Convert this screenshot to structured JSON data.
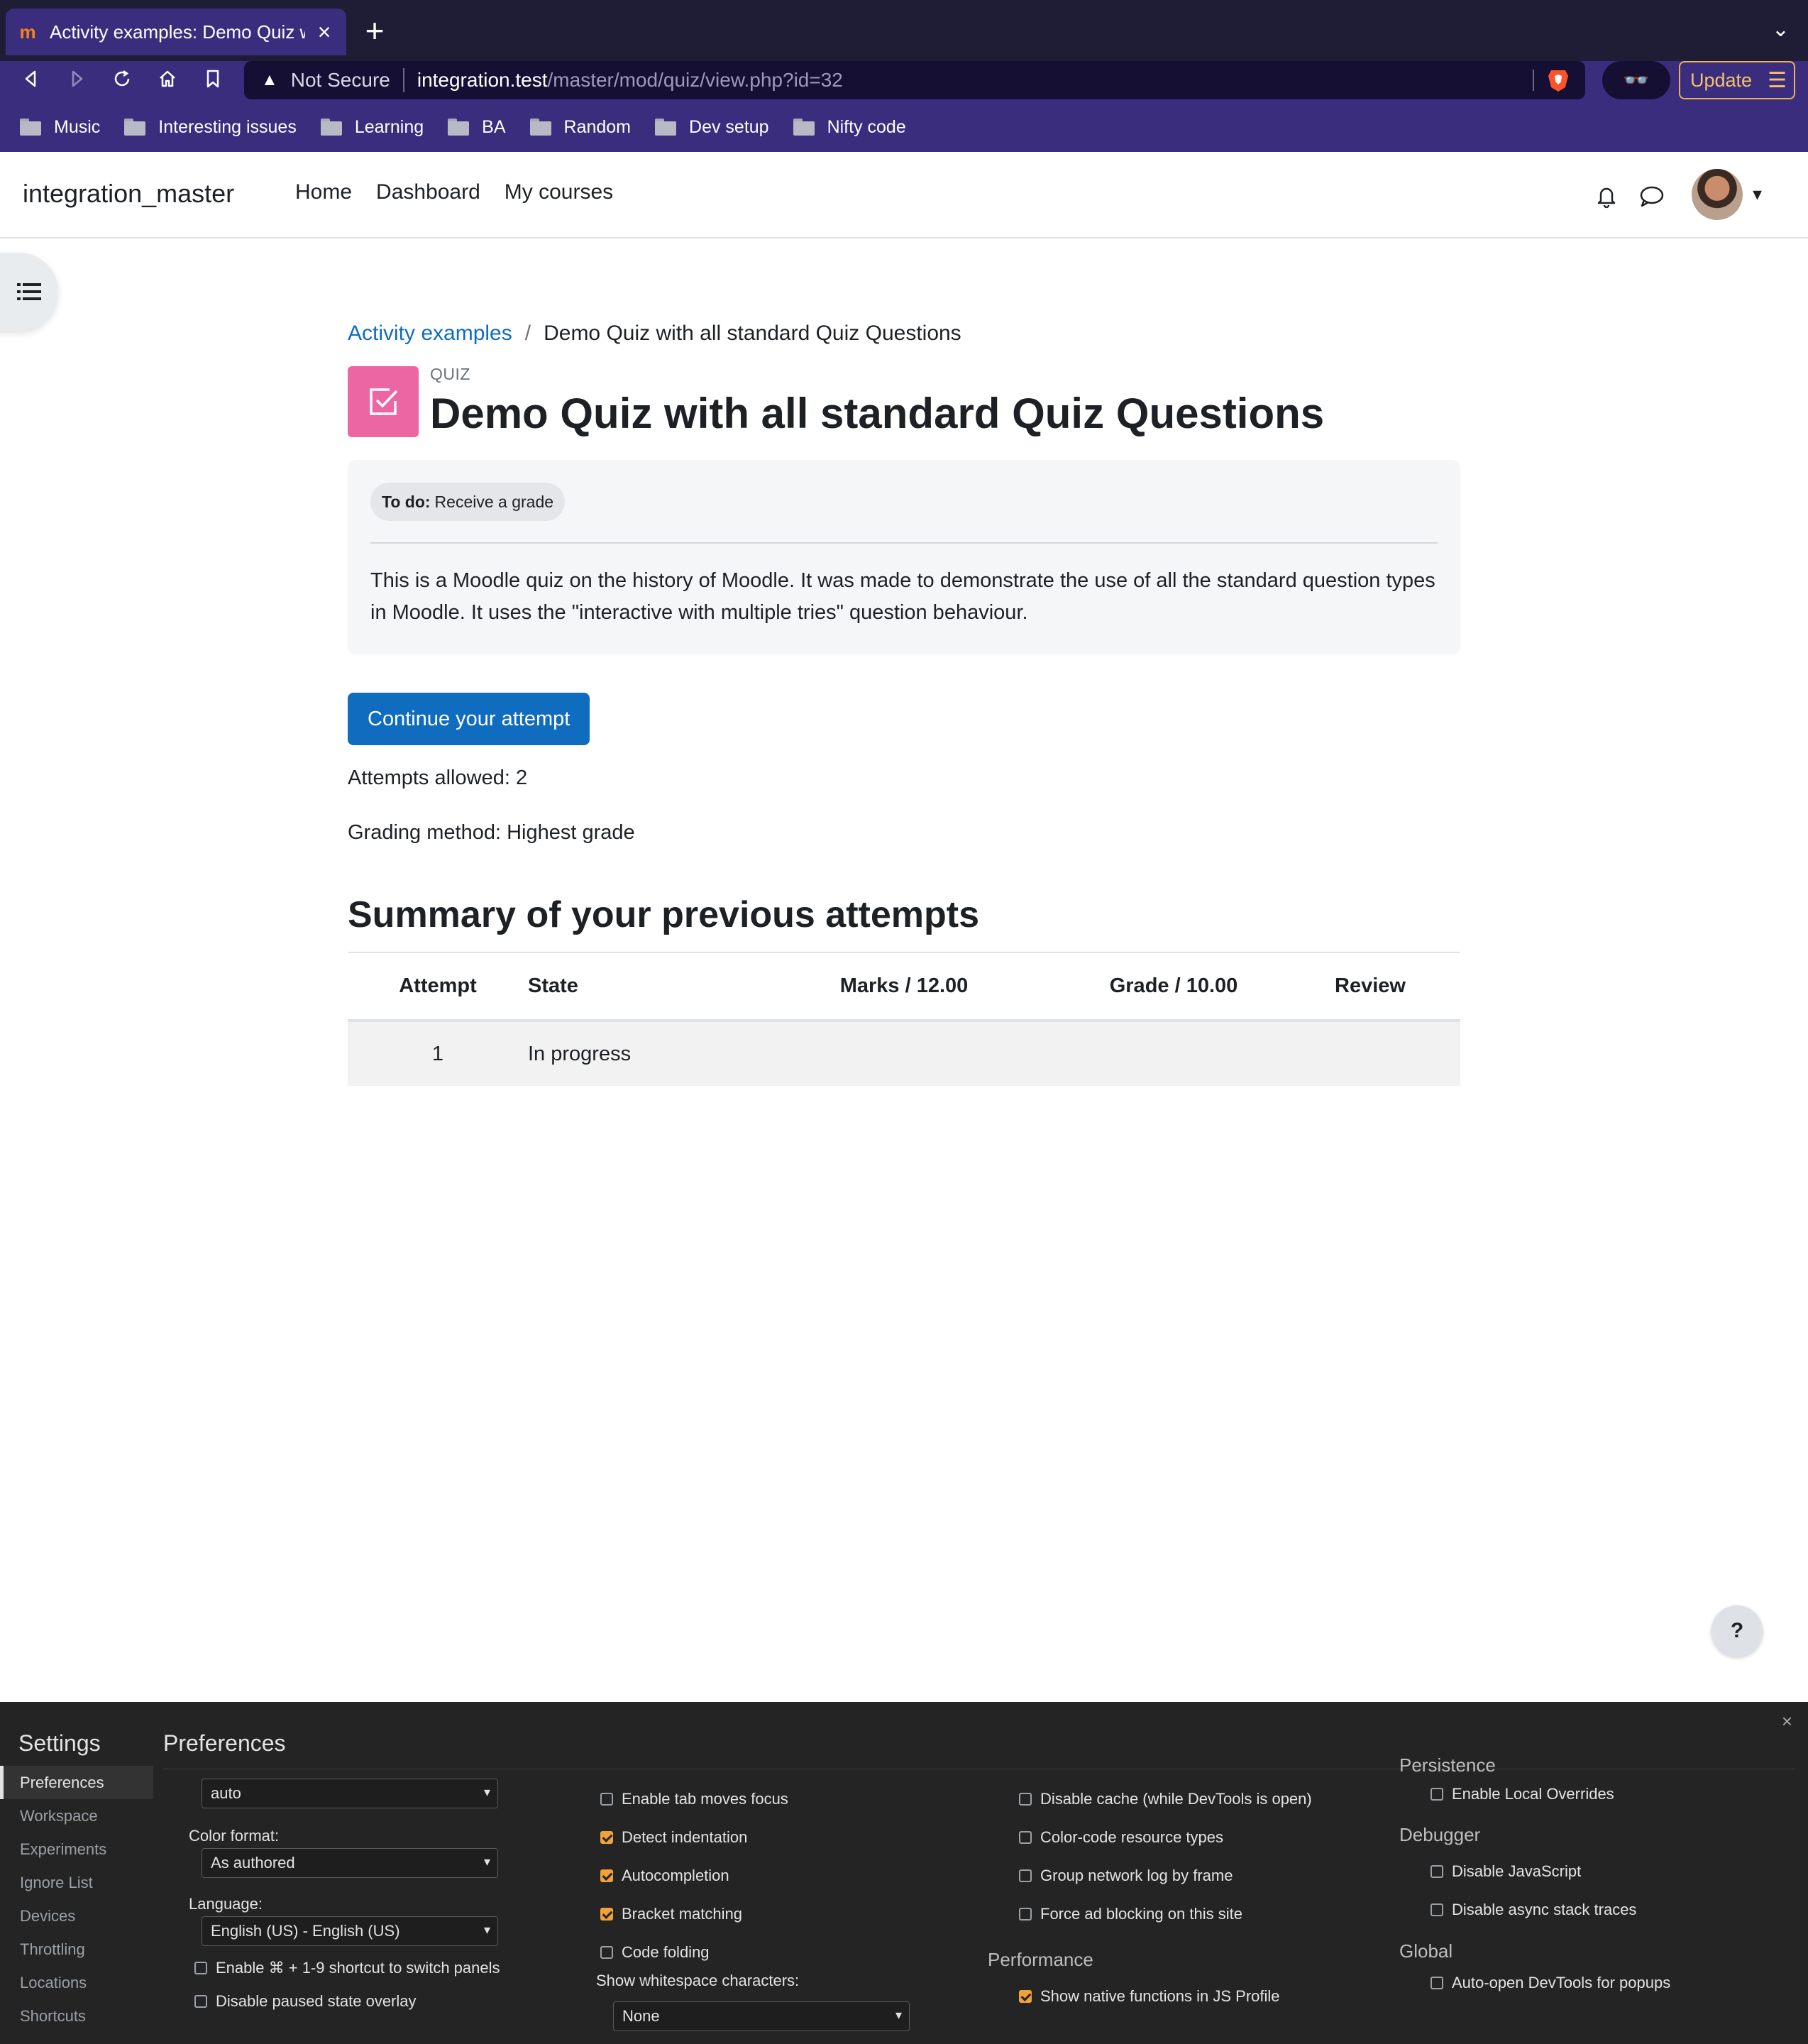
{
  "browser": {
    "tab_title": "Activity examples: Demo Quiz w",
    "new_tab": "+",
    "tab_close": "×",
    "tab_menu": "⌄",
    "url_warning": "Not Secure",
    "url_host": "integration.test",
    "url_path": "/master/mod/quiz/view.php?id=32",
    "update_label": "Update",
    "bookmarks": [
      "Music",
      "Interesting issues",
      "Learning",
      "BA",
      "Random",
      "Dev setup",
      "Nifty code"
    ]
  },
  "site": {
    "name": "integration_master",
    "nav": [
      "Home",
      "Dashboard",
      "My courses"
    ]
  },
  "breadcrumb": {
    "parent": "Activity examples",
    "separator": "/",
    "current": "Demo Quiz with all standard Quiz Questions"
  },
  "activity": {
    "type_label": "QUIZ",
    "title": "Demo Quiz with all standard Quiz Questions",
    "todo_label": "To do:",
    "todo_value": "Receive a grade",
    "intro": "This is a Moodle quiz on the history of Moodle. It was made to demonstrate the use of all the standard question types in Moodle. It uses the \"interactive with multiple tries\" question behaviour.",
    "accent_color": "#eb66a2"
  },
  "quiz": {
    "continue_label": "Continue your attempt",
    "attempts_allowed": "Attempts allowed: 2",
    "grading_method": "Grading method: Highest grade",
    "summary_heading": "Summary of your previous attempts",
    "columns": [
      "Attempt",
      "State",
      "Marks / 12.00",
      "Grade / 10.00",
      "Review"
    ],
    "rows": [
      {
        "attempt": "1",
        "state": "In progress",
        "marks": "",
        "grade": "",
        "review": ""
      }
    ],
    "primary_color": "#0f6cbf"
  },
  "help_label": "?",
  "devtools": {
    "heading": "Settings",
    "close": "×",
    "nav": [
      "Preferences",
      "Workspace",
      "Experiments",
      "Ignore List",
      "Devices",
      "Throttling",
      "Locations",
      "Shortcuts"
    ],
    "active_nav": "Preferences",
    "page_title": "Preferences",
    "col1": {
      "theme_value": "auto",
      "color_format_label": "Color format:",
      "color_format_value": "As authored",
      "language_label": "Language:",
      "language_value": "English (US) - English (US)",
      "checks": [
        {
          "label": "Enable ⌘ + 1-9 shortcut to switch panels",
          "checked": false
        },
        {
          "label": "Disable paused state overlay",
          "checked": false
        }
      ]
    },
    "col2": {
      "checks": [
        {
          "label": "Enable tab moves focus",
          "checked": false
        },
        {
          "label": "Detect indentation",
          "checked": true
        },
        {
          "label": "Autocompletion",
          "checked": true
        },
        {
          "label": "Bracket matching",
          "checked": true
        },
        {
          "label": "Code folding",
          "checked": false
        }
      ],
      "whitespace_label": "Show whitespace characters:",
      "whitespace_value": "None"
    },
    "col3": {
      "checks": [
        {
          "label": "Disable cache (while DevTools is open)",
          "checked": false
        },
        {
          "label": "Color-code resource types",
          "checked": false
        },
        {
          "label": "Group network log by frame",
          "checked": false
        },
        {
          "label": "Force ad blocking on this site",
          "checked": false
        }
      ],
      "performance_label": "Performance",
      "performance_checks": [
        {
          "label": "Show native functions in JS Profile",
          "checked": true
        }
      ]
    },
    "col4": {
      "persistence_label": "Persistence",
      "persistence_checks": [
        {
          "label": "Enable Local Overrides",
          "checked": false
        }
      ],
      "debugger_label": "Debugger",
      "debugger_checks": [
        {
          "label": "Disable JavaScript",
          "checked": false
        },
        {
          "label": "Disable async stack traces",
          "checked": false
        }
      ],
      "global_label": "Global",
      "global_checks": [
        {
          "label": "Auto-open DevTools for popups",
          "checked": false
        }
      ]
    }
  }
}
